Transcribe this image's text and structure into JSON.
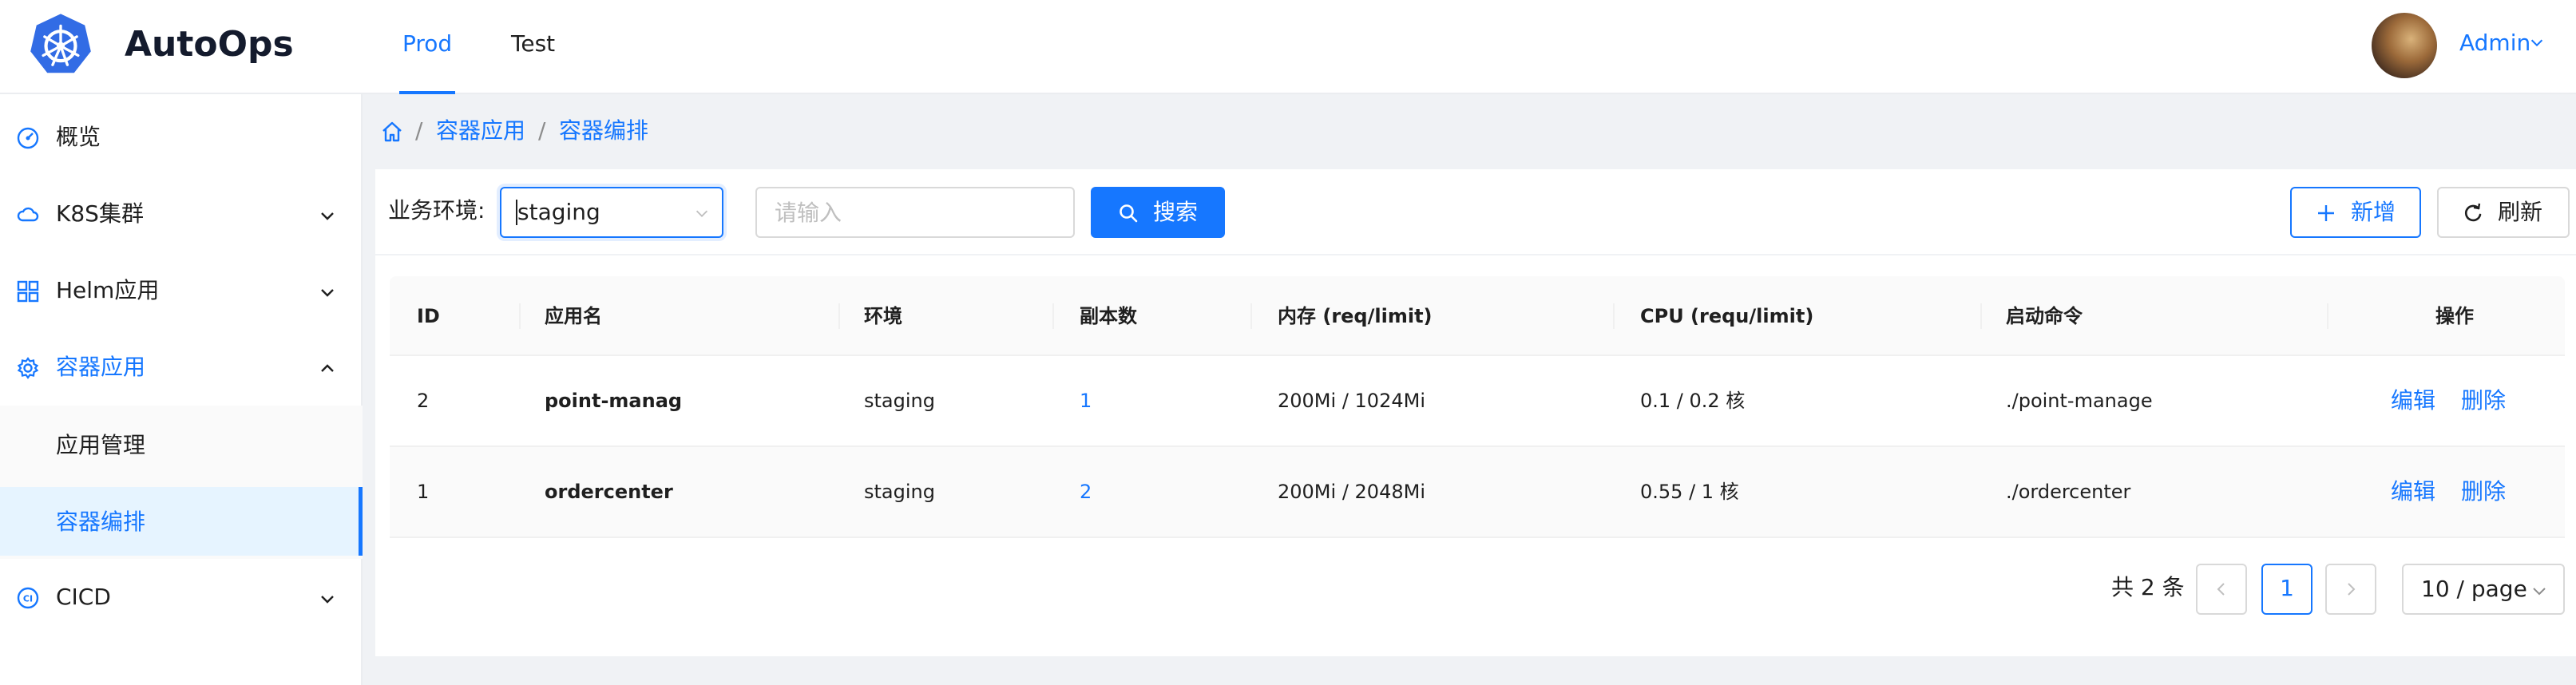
{
  "app": {
    "name": "AutoOps"
  },
  "top_tabs": [
    {
      "label": "Prod",
      "active": true
    },
    {
      "label": "Test",
      "active": false
    }
  ],
  "user": {
    "name": "Admin"
  },
  "sidebar": {
    "items": [
      {
        "label": "概览",
        "icon": "dashboard-icon"
      },
      {
        "label": "K8S集群",
        "icon": "cloud-icon"
      },
      {
        "label": "Helm应用",
        "icon": "appstore-icon"
      },
      {
        "label": "容器应用",
        "icon": "gear-icon",
        "open": true
      },
      {
        "label": "CICD",
        "icon": "ci-icon"
      }
    ],
    "subitems": [
      {
        "label": "应用管理",
        "active": false
      },
      {
        "label": "容器编排",
        "active": true
      }
    ]
  },
  "breadcrumb": {
    "items": [
      "容器应用",
      "容器编排"
    ],
    "separator": "/"
  },
  "search": {
    "env_label": "业务环境:",
    "env_value": "staging",
    "keyword_placeholder": "请输入",
    "search_label": "搜索",
    "add_label": "新增",
    "refresh_label": "刷新"
  },
  "table": {
    "columns": [
      "ID",
      "应用名",
      "环境",
      "副本数",
      "内存 (req/limit)",
      "CPU (requ/limit)",
      "启动命令",
      "操作"
    ],
    "rows": [
      {
        "id": "2",
        "name": "point-manag",
        "env": "staging",
        "replicas": "1",
        "memory": "200Mi / 1024Mi",
        "cpu": "0.1 / 0.2 核",
        "command": "./point-manage",
        "edit": "编辑",
        "delete": "删除"
      },
      {
        "id": "1",
        "name": "ordercenter",
        "env": "staging",
        "replicas": "2",
        "memory": "200Mi / 2048Mi",
        "cpu": "0.55 / 1 核",
        "command": "./ordercenter",
        "edit": "编辑",
        "delete": "删除"
      }
    ]
  },
  "pagination": {
    "total_text": "共 2 条",
    "current_page": "1",
    "page_size": "10 / page"
  },
  "colors": {
    "primary": "#1677ff",
    "background": "#f0f2f5",
    "brand_logo": "#326ce5"
  }
}
